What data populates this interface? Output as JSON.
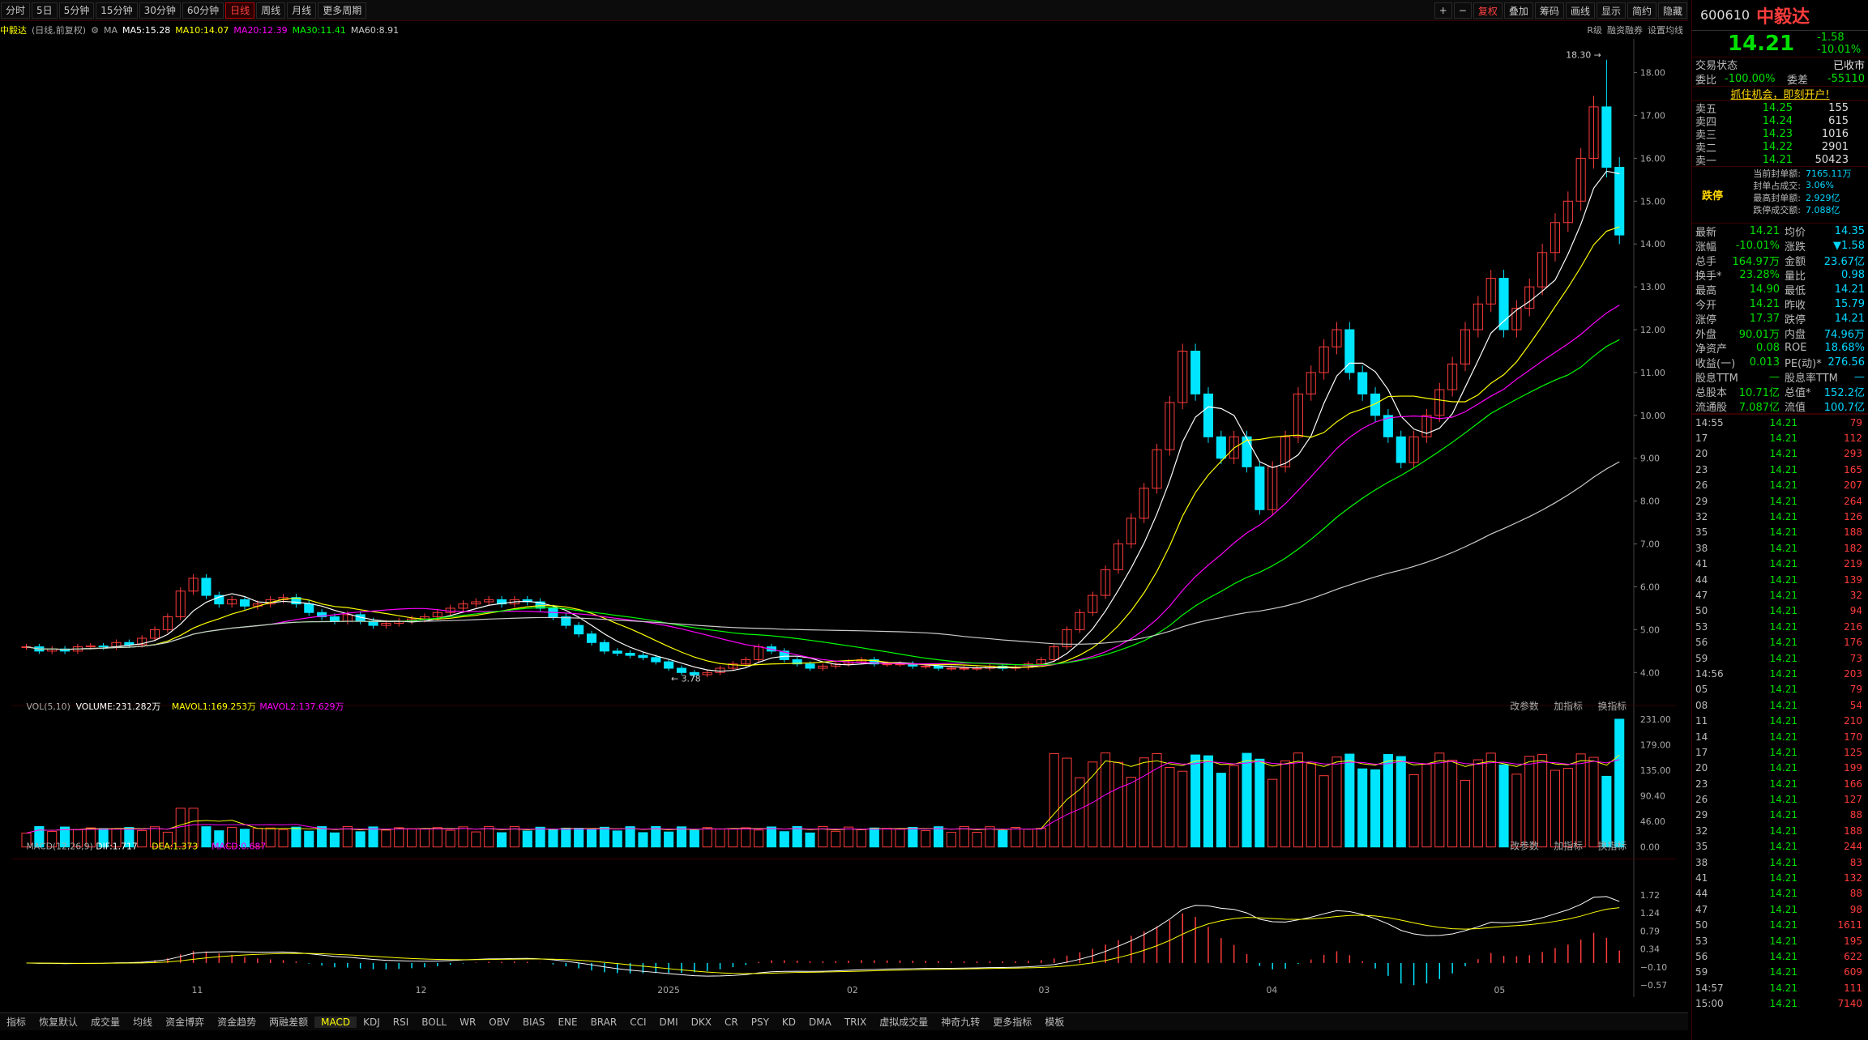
{
  "toolbar": {
    "periods": [
      "分时",
      "5日",
      "5分钟",
      "15分钟",
      "30分钟",
      "60分钟",
      "日线",
      "周线",
      "月线",
      "更多周期"
    ],
    "active": "日线",
    "right": [
      "+",
      "−",
      "复权",
      "叠加",
      "筹码",
      "画线",
      "显示",
      "简约",
      "隐藏"
    ]
  },
  "legend": {
    "name": "中毅达",
    "type": "(日线,前复权)",
    "ma5": "MA5:15.28",
    "ma10": "MA10:14.07",
    "ma20": "MA20:12.39",
    "ma30": "MA30:11.41",
    "ma60": "MA60:8.91",
    "right1": "R级",
    "right2": "融资融券",
    "right3": "设置均线"
  },
  "vol_legend": {
    "title": "VOL(5,10)",
    "vol": "VOLUME:231.282万",
    "mavol1": "MAVOL1:169.253万",
    "mavol2": "MAVOL2:137.629万",
    "btns": [
      "改参数",
      "加指标",
      "换指标"
    ]
  },
  "macd_legend": {
    "title": "MACD(12,26,9)",
    "dif": "DIF:1.717",
    "dea": "DEA:1.373",
    "macd": "MACD:0.687",
    "btns": [
      "改参数",
      "加指标",
      "换指标"
    ]
  },
  "price_axis": [
    "18.00",
    "17.00",
    "16.00",
    "15.00",
    "14.00",
    "13.00",
    "12.00",
    "11.00",
    "10.00",
    "9.00",
    "8.00",
    "7.00",
    "6.00",
    "5.00",
    "4.00"
  ],
  "vol_axis": [
    "231.00",
    "179.00",
    "135.00",
    "90.40",
    "46.00",
    "0.00"
  ],
  "macd_axis": [
    "1.72",
    "1.24",
    "0.79",
    "0.34",
    "−0.10",
    "−0.57"
  ],
  "x_axis": [
    "11",
    "12",
    "2025",
    "02",
    "03",
    "04",
    "05"
  ],
  "annot": {
    "high": "18.30",
    "low": "3.78"
  },
  "bottom": [
    "指标",
    "恢复默认",
    "成交量",
    "均线",
    "资金博弈",
    "资金趋势",
    "两融差额",
    "MACD",
    "KDJ",
    "RSI",
    "BOLL",
    "WR",
    "OBV",
    "BIAS",
    "ENE",
    "BRAR",
    "CCI",
    "DMI",
    "DKX",
    "CR",
    "PSY",
    "KD",
    "DMA",
    "TRIX",
    "虚拟成交量",
    "神奇九转",
    "更多指标",
    "模板"
  ],
  "quote": {
    "code": "600610",
    "name": "中毅达",
    "price": "14.21",
    "chg": "-1.58",
    "pct": "-10.01%",
    "status_l": "交易状态",
    "status_r": "已收市",
    "wb_l": "委比",
    "wb": "-100.00%",
    "wc_l": "委差",
    "wc": "-55110",
    "ad": "抓住机会，即刻开户!",
    "asks": [
      [
        "卖五",
        "14.25",
        "155"
      ],
      [
        "卖四",
        "14.24",
        "615"
      ],
      [
        "卖三",
        "14.23",
        "1016"
      ],
      [
        "卖二",
        "14.22",
        "2901"
      ],
      [
        "卖一",
        "14.21",
        "50423"
      ]
    ],
    "limit_label": "跌停",
    "limit": [
      [
        "当前封单额:",
        "7165.11万"
      ],
      [
        "封单占成交:",
        "3.06%"
      ],
      [
        "最高封单额:",
        "2.929亿"
      ],
      [
        "跌停成交额:",
        "7.088亿"
      ]
    ],
    "stats": [
      [
        "最新",
        "14.21",
        "均价",
        "14.35"
      ],
      [
        "涨幅",
        "-10.01%",
        "涨跌",
        "▼1.58"
      ],
      [
        "总手",
        "164.97万",
        "金额",
        "23.67亿"
      ],
      [
        "换手*",
        "23.28%",
        "量比",
        "0.98"
      ],
      [
        "最高",
        "14.90",
        "最低",
        "14.21"
      ],
      [
        "今开",
        "14.21",
        "昨收",
        "15.79"
      ],
      [
        "涨停",
        "17.37",
        "跌停",
        "14.21"
      ],
      [
        "外盘",
        "90.01万",
        "内盘",
        "74.96万"
      ],
      [
        "净资产",
        "0.08",
        "ROE",
        "18.68%"
      ],
      [
        "收益(一)",
        "0.013",
        "PE(动)*",
        "276.56"
      ],
      [
        "股息TTM",
        "—",
        "股息率TTM",
        "—"
      ],
      [
        "总股本",
        "10.71亿",
        "总值*",
        "152.2亿"
      ],
      [
        "流通股",
        "7.087亿",
        "流值",
        "100.7亿"
      ]
    ],
    "ticks": [
      [
        "14:55",
        "14.21",
        "79"
      ],
      [
        "17",
        "14.21",
        "112"
      ],
      [
        "20",
        "14.21",
        "293"
      ],
      [
        "23",
        "14.21",
        "165"
      ],
      [
        "26",
        "14.21",
        "207"
      ],
      [
        "29",
        "14.21",
        "264"
      ],
      [
        "32",
        "14.21",
        "126"
      ],
      [
        "35",
        "14.21",
        "188"
      ],
      [
        "38",
        "14.21",
        "182"
      ],
      [
        "41",
        "14.21",
        "219"
      ],
      [
        "44",
        "14.21",
        "139"
      ],
      [
        "47",
        "14.21",
        "32"
      ],
      [
        "50",
        "14.21",
        "94"
      ],
      [
        "53",
        "14.21",
        "216"
      ],
      [
        "56",
        "14.21",
        "176"
      ],
      [
        "59",
        "14.21",
        "73"
      ],
      [
        "14:56",
        "14.21",
        "203"
      ],
      [
        "05",
        "14.21",
        "79"
      ],
      [
        "08",
        "14.21",
        "54"
      ],
      [
        "11",
        "14.21",
        "210"
      ],
      [
        "14",
        "14.21",
        "170"
      ],
      [
        "17",
        "14.21",
        "125"
      ],
      [
        "20",
        "14.21",
        "199"
      ],
      [
        "23",
        "14.21",
        "166"
      ],
      [
        "26",
        "14.21",
        "127"
      ],
      [
        "29",
        "14.21",
        "88"
      ],
      [
        "32",
        "14.21",
        "188"
      ],
      [
        "35",
        "14.21",
        "244"
      ],
      [
        "38",
        "14.21",
        "83"
      ],
      [
        "41",
        "14.21",
        "132"
      ],
      [
        "44",
        "14.21",
        "88"
      ],
      [
        "47",
        "14.21",
        "98"
      ],
      [
        "50",
        "14.21",
        "1611"
      ],
      [
        "53",
        "14.21",
        "195"
      ],
      [
        "56",
        "14.21",
        "622"
      ],
      [
        "59",
        "14.21",
        "609"
      ],
      [
        "14:57",
        "14.21",
        "111"
      ],
      [
        "15:00",
        "14.21",
        "7140"
      ]
    ]
  },
  "chart_data": {
    "type": "candlestick",
    "price_range": [
      3.6,
      18.6
    ],
    "description_free": true,
    "closes": [
      4.6,
      4.5,
      4.55,
      4.5,
      4.6,
      4.62,
      4.6,
      4.7,
      4.65,
      4.8,
      5.0,
      5.3,
      5.9,
      6.2,
      5.8,
      5.6,
      5.7,
      5.55,
      5.6,
      5.7,
      5.75,
      5.6,
      5.4,
      5.3,
      5.2,
      5.35,
      5.2,
      5.1,
      5.15,
      5.2,
      5.25,
      5.3,
      5.4,
      5.5,
      5.6,
      5.65,
      5.7,
      5.6,
      5.7,
      5.65,
      5.5,
      5.3,
      5.1,
      4.9,
      4.7,
      4.5,
      4.45,
      4.4,
      4.35,
      4.25,
      4.1,
      4.0,
      3.95,
      4.0,
      4.1,
      4.2,
      4.3,
      4.6,
      4.5,
      4.3,
      4.2,
      4.1,
      4.15,
      4.2,
      4.25,
      4.3,
      4.2,
      4.2,
      4.2,
      4.15,
      4.15,
      4.1,
      4.1,
      4.1,
      4.1,
      4.15,
      4.1,
      4.12,
      4.2,
      4.3,
      4.6,
      5.0,
      5.4,
      5.8,
      6.4,
      7.0,
      7.6,
      8.3,
      9.2,
      10.3,
      11.5,
      10.5,
      9.5,
      9.0,
      9.5,
      8.8,
      7.8,
      8.8,
      9.5,
      10.5,
      11.0,
      11.6,
      12.0,
      11.0,
      10.5,
      10.0,
      9.5,
      8.9,
      9.5,
      10.0,
      10.6,
      11.2,
      12.0,
      12.6,
      13.2,
      12.0,
      12.5,
      13.0,
      13.8,
      14.5,
      15.0,
      16.0,
      17.2,
      15.79,
      14.21
    ]
  }
}
